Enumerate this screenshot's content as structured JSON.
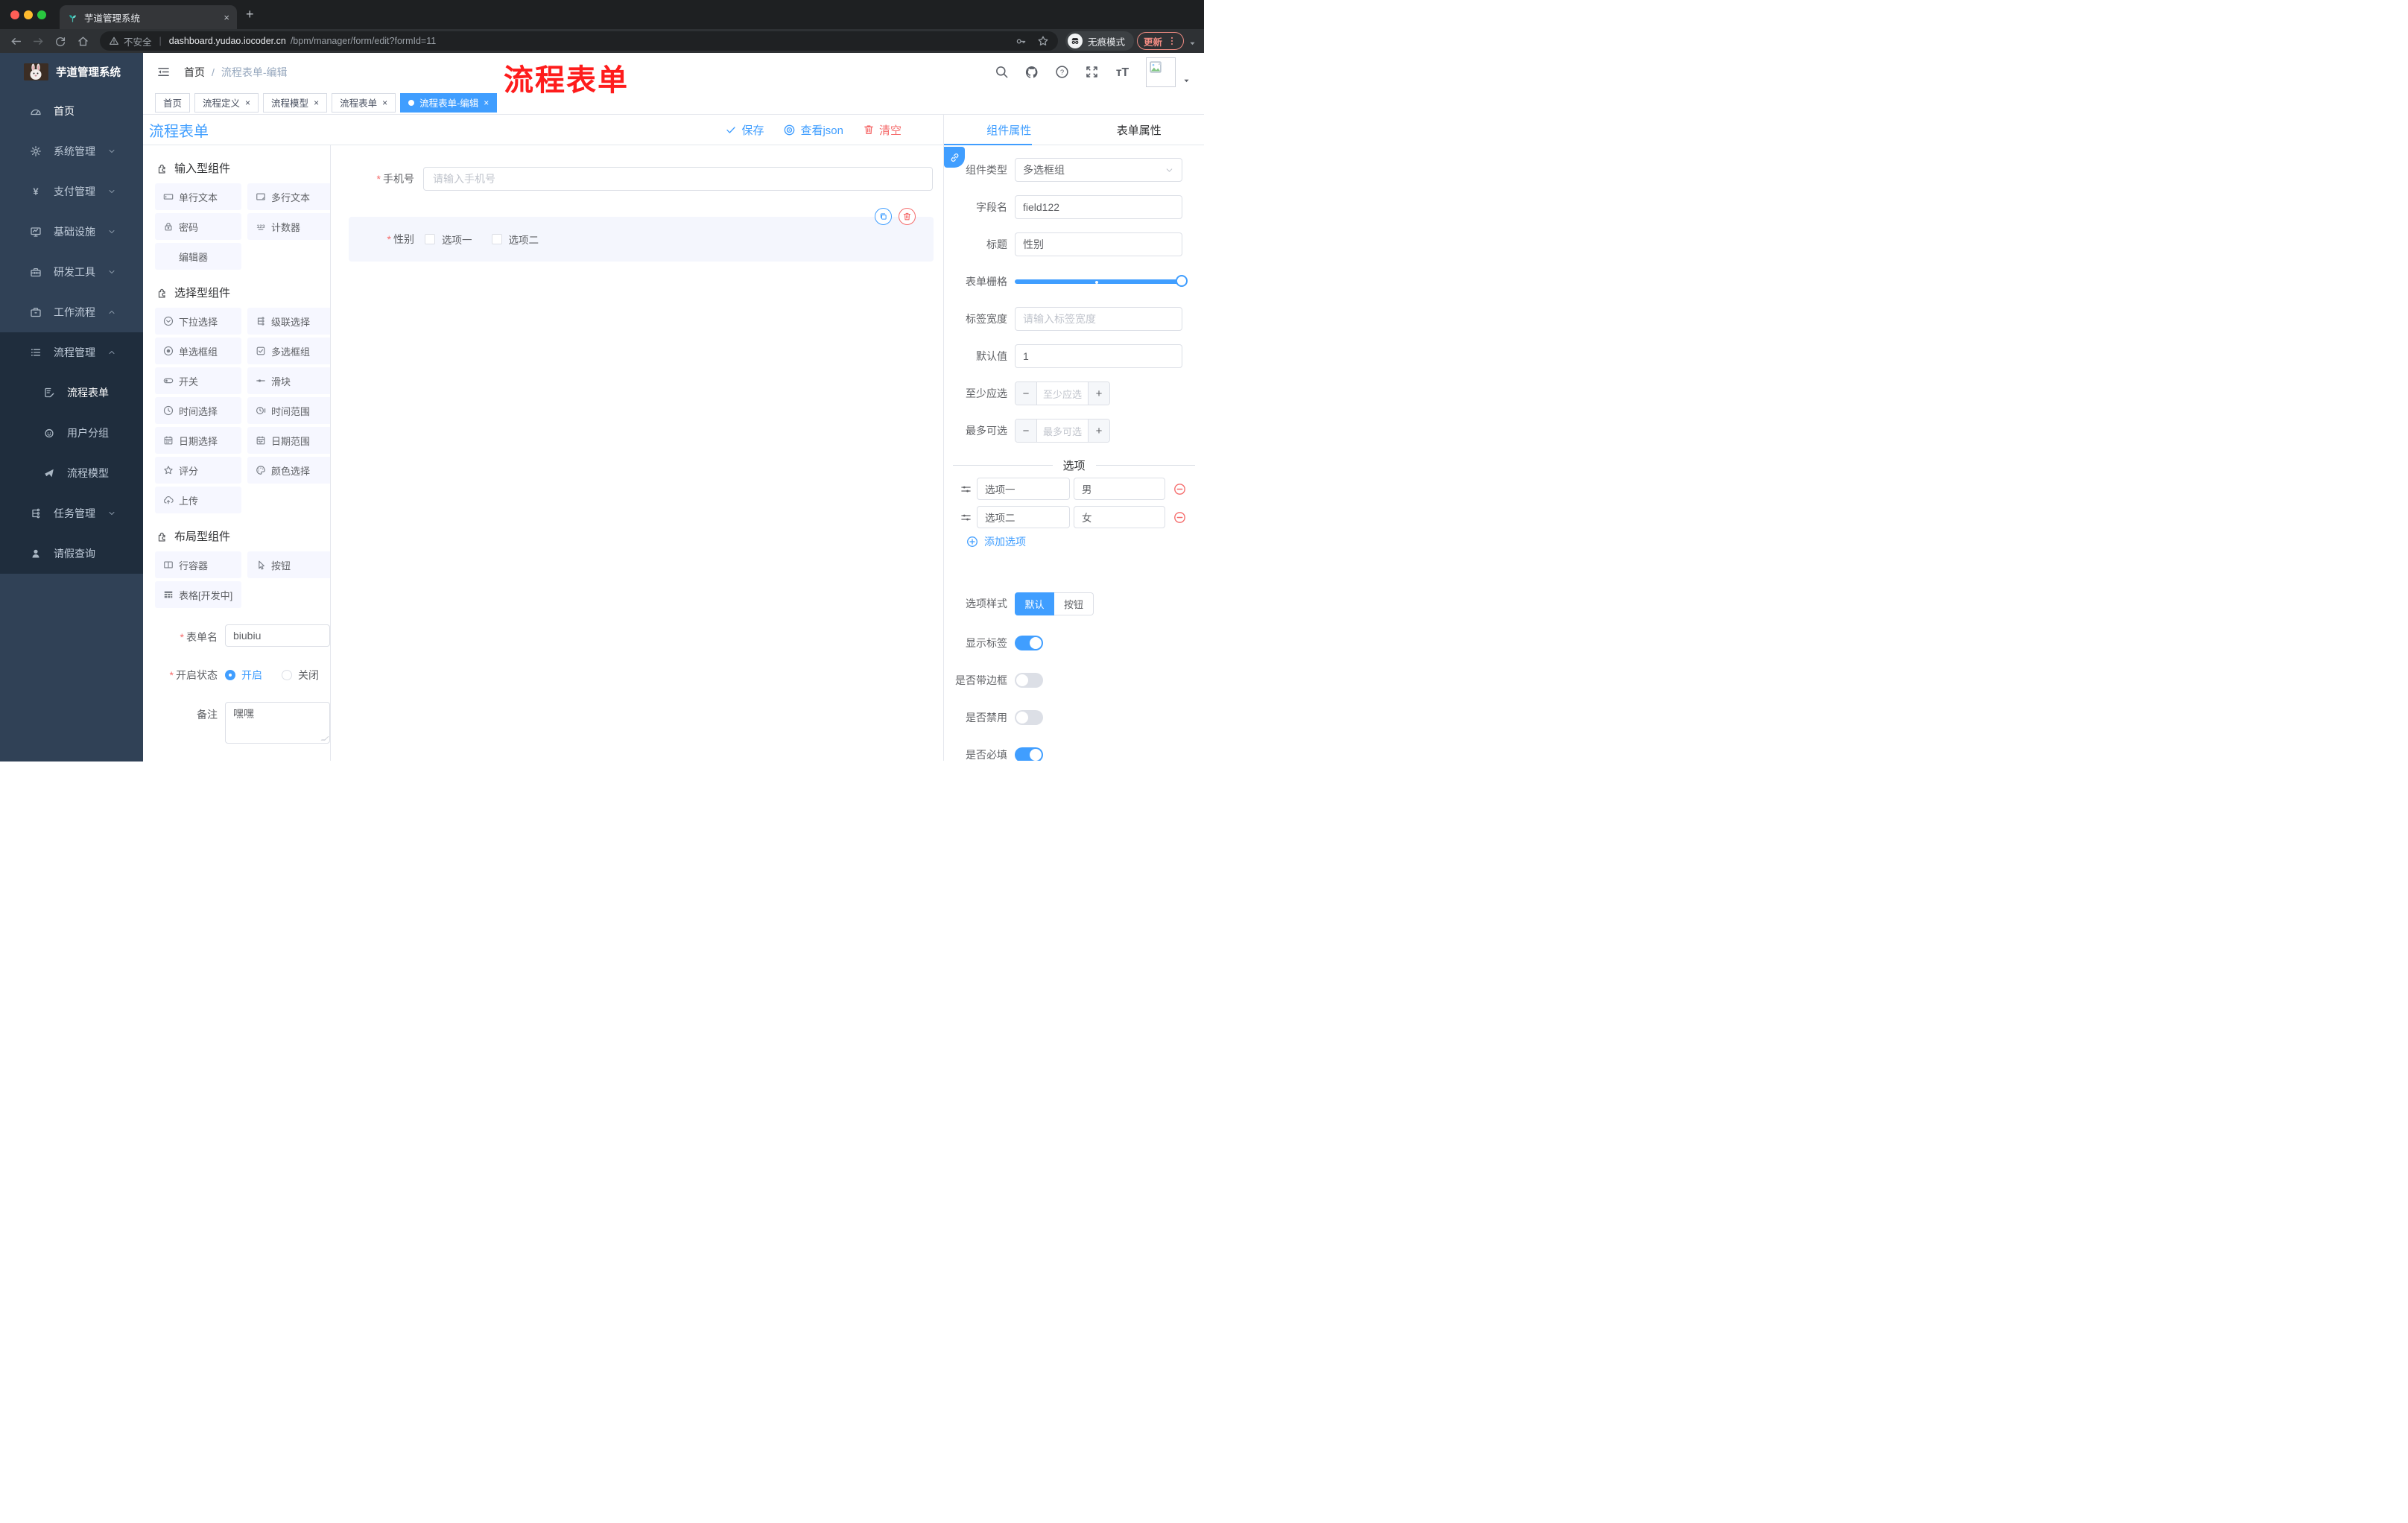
{
  "colors": {
    "accent": "#409eff",
    "danger": "#f56c6c",
    "sidebar_bg": "#304156",
    "submenu_bg": "#1f2d3d",
    "active_tab": "#409eff",
    "watermark": "#fe1c1c"
  },
  "browser": {
    "tab_title": "芋道管理系统",
    "new_tab_label": "+",
    "close_label": "×",
    "security_label": "不安全",
    "url_host": "dashboard.yudao.iocoder.cn",
    "url_path": "/bpm/manager/form/edit?formId=11",
    "incognito_label": "无痕模式",
    "update_label": "更新"
  },
  "sidebar": {
    "brand": "芋道管理系统",
    "items": [
      {
        "icon": "dashboard-icon",
        "label": "首页",
        "level": 1,
        "active": true,
        "chevron": ""
      },
      {
        "icon": "gear-icon",
        "label": "系统管理",
        "level": 1,
        "chevron": "down"
      },
      {
        "icon": "yen-icon",
        "label": "支付管理",
        "level": 1,
        "chevron": "down"
      },
      {
        "icon": "monitor-icon",
        "label": "基础设施",
        "level": 1,
        "chevron": "down"
      },
      {
        "icon": "toolbox-icon",
        "label": "研发工具",
        "level": 1,
        "chevron": "down"
      },
      {
        "icon": "briefcase-icon",
        "label": "工作流程",
        "level": 1,
        "chevron": "up"
      }
    ],
    "submenu": [
      {
        "icon": "list-icon",
        "label": "流程管理",
        "level": 2,
        "chevron": "up"
      },
      {
        "icon": "form-doc-icon",
        "label": "流程表单",
        "level": 3,
        "active": true,
        "chevron": ""
      },
      {
        "icon": "user-group-icon",
        "label": "用户分组",
        "level": 3,
        "chevron": ""
      },
      {
        "icon": "paper-plane-icon",
        "label": "流程模型",
        "level": 3,
        "chevron": ""
      },
      {
        "icon": "tree-icon",
        "label": "任务管理",
        "level": 2,
        "chevron": "down"
      },
      {
        "icon": "person-icon",
        "label": "请假查询",
        "level": 2,
        "chevron": ""
      }
    ]
  },
  "header": {
    "breadcrumb_home": "首页",
    "breadcrumb_sep": "/",
    "breadcrumb_current": "流程表单-编辑",
    "watermark": "流程表单"
  },
  "route_tabs": [
    {
      "label": "首页",
      "closable": false,
      "active": false
    },
    {
      "label": "流程定义",
      "closable": true,
      "active": false
    },
    {
      "label": "流程模型",
      "closable": true,
      "active": false
    },
    {
      "label": "流程表单",
      "closable": true,
      "active": false
    },
    {
      "label": "流程表单-编辑",
      "closable": true,
      "active": true
    }
  ],
  "toolbar": {
    "title": "流程表单",
    "save_label": "保存",
    "view_json_label": "查看json",
    "clear_label": "清空"
  },
  "palette": {
    "sections": [
      {
        "title": "输入型组件",
        "icon": "puzzle-icon",
        "items": [
          {
            "icon": "input-box-icon",
            "label": "单行文本"
          },
          {
            "icon": "textarea-icon",
            "label": "多行文本"
          },
          {
            "icon": "lock-icon",
            "label": "密码"
          },
          {
            "icon": "counter-icon",
            "label": "计数器"
          },
          {
            "icon": "",
            "label": "编辑器"
          }
        ]
      },
      {
        "title": "选择型组件",
        "icon": "puzzle-icon",
        "items": [
          {
            "icon": "select-icon",
            "label": "下拉选择"
          },
          {
            "icon": "cascader-icon",
            "label": "级联选择"
          },
          {
            "icon": "radio-icon",
            "label": "单选框组"
          },
          {
            "icon": "checkbox-icon",
            "label": "多选框组"
          },
          {
            "icon": "switch-icon",
            "label": "开关"
          },
          {
            "icon": "slider-icon",
            "label": "滑块"
          },
          {
            "icon": "clock-icon",
            "label": "时间选择"
          },
          {
            "icon": "time-range-icon",
            "label": "时间范围"
          },
          {
            "icon": "calendar-icon",
            "label": "日期选择"
          },
          {
            "icon": "date-range-icon",
            "label": "日期范围"
          },
          {
            "icon": "star-icon",
            "label": "评分"
          },
          {
            "icon": "palette-icon",
            "label": "颜色选择"
          },
          {
            "icon": "upload-icon",
            "label": "上传"
          }
        ]
      },
      {
        "title": "布局型组件",
        "icon": "puzzle-icon",
        "items": [
          {
            "icon": "columns-icon",
            "label": "行容器"
          },
          {
            "icon": "pointer-icon",
            "label": "按钮"
          },
          {
            "icon": "table-icon",
            "label": "表格[开发中]"
          }
        ]
      }
    ],
    "form": {
      "name_label": "表单名",
      "name_value": "biubiu",
      "status_label": "开启状态",
      "status_on": "开启",
      "status_off": "关闭",
      "remark_label": "备注",
      "remark_value": "嘿嘿"
    }
  },
  "canvas": {
    "phone": {
      "label": "手机号",
      "placeholder": "请输入手机号"
    },
    "gender": {
      "label": "性别",
      "options": [
        "选项一",
        "选项二"
      ]
    }
  },
  "panel": {
    "tab_component": "组件属性",
    "tab_form": "表单属性",
    "type_label": "组件类型",
    "type_value": "多选框组",
    "field_label": "字段名",
    "field_value": "field122",
    "title_label": "标题",
    "title_value": "性别",
    "grid_label": "表单栅格",
    "width_label": "标签宽度",
    "width_placeholder": "请输入标签宽度",
    "default_label": "默认值",
    "default_value": "1",
    "min_label": "至少应选",
    "min_placeholder": "至少应选",
    "max_label": "最多可选",
    "max_placeholder": "最多可选",
    "options_divider": "选项",
    "option_rows": [
      {
        "label": "选项一",
        "value": "男"
      },
      {
        "label": "选项二",
        "value": "女"
      }
    ],
    "add_option_label": "添加选项",
    "style_label": "选项样式",
    "style_default": "默认",
    "style_button": "按钮",
    "toggles": [
      {
        "label": "显示标签",
        "on": true
      },
      {
        "label": "是否带边框",
        "on": false
      },
      {
        "label": "是否禁用",
        "on": false
      },
      {
        "label": "是否必填",
        "on": true
      }
    ]
  }
}
